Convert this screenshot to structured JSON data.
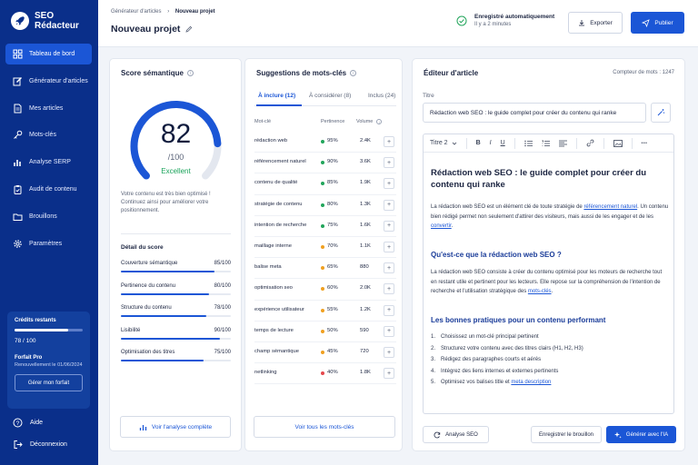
{
  "brand": {
    "line1": "SEO",
    "line2": "Rédacteur"
  },
  "nav": [
    {
      "label": "Tableau de bord",
      "icon": "grid-icon",
      "active": true
    },
    {
      "label": "Générateur d'articles",
      "icon": "pencil-icon"
    },
    {
      "label": "Mes articles",
      "icon": "document-icon"
    },
    {
      "label": "Mots-clés",
      "icon": "key-icon"
    },
    {
      "label": "Analyse SERP",
      "icon": "bar-chart-icon"
    },
    {
      "label": "Audit de contenu",
      "icon": "clipboard-icon"
    },
    {
      "label": "Brouillons",
      "icon": "folder-icon"
    },
    {
      "label": "Paramètres",
      "icon": "gear-icon"
    }
  ],
  "credits": {
    "label": "Crédits restants",
    "value": "78 / 100",
    "fraction": 0.78,
    "plan": "Forfait Pro",
    "renewal": "Renouvellement le 01/06/2024",
    "manage_label": "Gérer mon forfait"
  },
  "sidebar_bottom": {
    "help": "Aide",
    "logout": "Déconnexion"
  },
  "header": {
    "breadcrumb_parent": "Générateur d'articles",
    "breadcrumb_sep": "›",
    "breadcrumb_current": "Nouveau projet",
    "title": "Nouveau projet",
    "autosave_title": "Enregistré automatiquement",
    "autosave_time": "Il y a 2 minutes",
    "export_label": "Exporter",
    "publish_label": "Publier"
  },
  "score": {
    "title": "Score sémantique",
    "value": "82",
    "fraction": 0.82,
    "denominator": "/100",
    "label": "Excellent",
    "description": "Votre contenu est très bien optimisé ! Continuez ainsi pour améliorer votre positionnement.",
    "detail_title": "Détail du score",
    "details": [
      {
        "label": "Couverture sémantique",
        "value": "85/100",
        "fraction": 0.85
      },
      {
        "label": "Pertinence du contenu",
        "value": "80/100",
        "fraction": 0.8
      },
      {
        "label": "Structure du contenu",
        "value": "78/100",
        "fraction": 0.78
      },
      {
        "label": "Lisibilité",
        "value": "90/100",
        "fraction": 0.9
      },
      {
        "label": "Optimisation des titres",
        "value": "75/100",
        "fraction": 0.75
      }
    ],
    "analysis_link": "Voir l'analyse complète"
  },
  "keywords": {
    "title": "Suggestions de mots-clés",
    "tabs": [
      "À inclure (12)",
      "À considérer (8)",
      "Inclus (24)"
    ],
    "col_keyword": "Mot-clé",
    "col_relevance": "Pertinence",
    "col_volume": "Volume",
    "colors": {
      "high": "#22a55b",
      "mid": "#f0a020",
      "low": "#e5484d"
    },
    "rows": [
      {
        "kw": "rédaction web",
        "pct": "95%",
        "vol": "2.4K",
        "level": "high"
      },
      {
        "kw": "référencement naturel",
        "pct": "90%",
        "vol": "3.6K",
        "level": "high"
      },
      {
        "kw": "contenu de qualité",
        "pct": "85%",
        "vol": "1.9K",
        "level": "high"
      },
      {
        "kw": "stratégie de contenu",
        "pct": "80%",
        "vol": "1.3K",
        "level": "high"
      },
      {
        "kw": "intention de recherche",
        "pct": "75%",
        "vol": "1.6K",
        "level": "high"
      },
      {
        "kw": "maillage interne",
        "pct": "70%",
        "vol": "1.1K",
        "level": "mid"
      },
      {
        "kw": "balise meta",
        "pct": "65%",
        "vol": "880",
        "level": "mid"
      },
      {
        "kw": "optimisation seo",
        "pct": "60%",
        "vol": "2.0K",
        "level": "mid"
      },
      {
        "kw": "expérience utilisateur",
        "pct": "55%",
        "vol": "1.2K",
        "level": "mid"
      },
      {
        "kw": "temps de lecture",
        "pct": "50%",
        "vol": "590",
        "level": "mid"
      },
      {
        "kw": "champ sémantique",
        "pct": "45%",
        "vol": "720",
        "level": "mid"
      },
      {
        "kw": "netlinking",
        "pct": "40%",
        "vol": "1.8K",
        "level": "low"
      }
    ],
    "add_symbol": "+",
    "see_all": "Voir tous les mots-clés"
  },
  "editor": {
    "title": "Éditeur d'article",
    "word_count": "Compteur de mots : 1247",
    "title_label": "Titre",
    "title_value": "Rédaction web SEO : le guide complet pour créer du contenu qui ranke",
    "heading_select": "Titre 2",
    "tb_bold": "B",
    "tb_italic": "I",
    "tb_underline": "U",
    "tb_more": "•••",
    "h1": "Rédaction web SEO : le guide complet pour créer du contenu qui ranke",
    "p1_a": "La rédaction web SEO est un élément clé de toute stratégie de ",
    "p1_link1": "référencement naturel",
    "p1_b": ". Un contenu bien rédigé permet non seulement d'attirer des visiteurs, mais aussi de les engager et de les ",
    "p1_link2": "convertir",
    "p1_c": ".",
    "h2a": "Qu'est-ce que la rédaction web SEO ?",
    "p2_a": "La rédaction web SEO consiste à créer du contenu optimisé pour les moteurs de recherche tout en restant utile et pertinent pour les lecteurs. Elle repose sur la compréhension de l'intention de recherche et l'utilisation stratégique des ",
    "p2_link": "mots-clés",
    "p2_b": ".",
    "h2b": "Les bonnes pratiques pour un contenu performant",
    "list": [
      {
        "n": "1.",
        "text": "Choisissez un mot-clé principal pertinent"
      },
      {
        "n": "2.",
        "text": "Structurez votre contenu avec des titres clairs (H1, H2, H3)"
      },
      {
        "n": "3.",
        "text": "Rédigez des paragraphes courts et aérés"
      },
      {
        "n": "4.",
        "text": "Intégrez des liens internes et externes pertinents"
      },
      {
        "n": "5.",
        "text": "Optimisez vos balises title et ",
        "link": "meta description"
      }
    ],
    "btn_analyze": "Analyse SEO",
    "btn_draft": "Enregistrer le brouillon",
    "btn_generate": "Générer avec l'IA"
  }
}
